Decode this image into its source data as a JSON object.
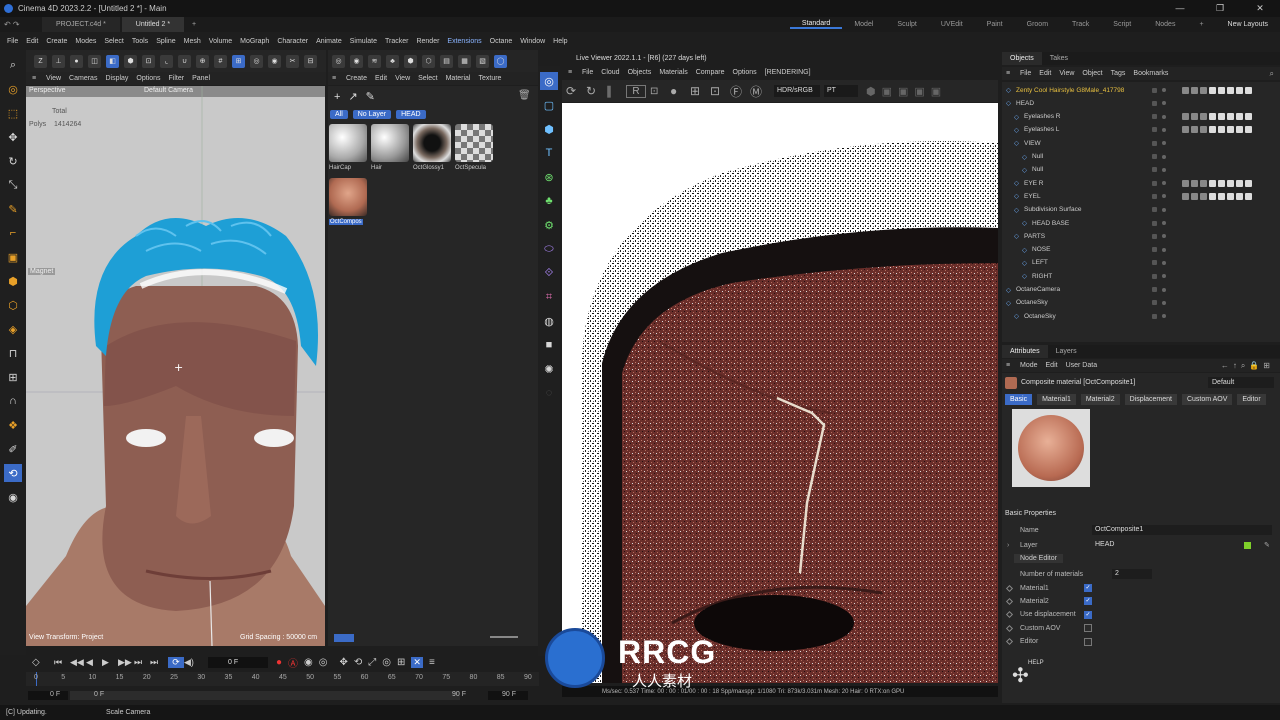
{
  "window": {
    "title": "Cinema 4D 2023.2.2 - [Untitled 2 *] - Main",
    "controls": [
      "—",
      "❐",
      "✕"
    ]
  },
  "file_tabs": [
    {
      "label": "PROJECT.c4d *",
      "active": false
    },
    {
      "label": "Untitled 2 *",
      "active": true
    },
    {
      "label": "+",
      "active": false
    }
  ],
  "layouts": [
    "Standard",
    "Model",
    "Sculpt",
    "UVEdit",
    "Paint",
    "Groom",
    "Track",
    "Script",
    "Nodes",
    "+",
    "New Layouts"
  ],
  "menubar": [
    "File",
    "Edit",
    "Create",
    "Modes",
    "Select",
    "Tools",
    "Spline",
    "Mesh",
    "Volume",
    "MoGraph",
    "Character",
    "Animate",
    "Simulate",
    "Tracker",
    "Render",
    "Extensions",
    "Octane",
    "Window",
    "Help"
  ],
  "viewport": {
    "menu": [
      "View",
      "Cameras",
      "Display",
      "Options",
      "Filter",
      "Panel"
    ],
    "label": "Perspective",
    "camera": "Default Camera",
    "total_label": "Total",
    "polys_label": "Polys",
    "polys_value": "1414264",
    "magnet_label": "Magnet",
    "transform_label": "View Transform: Project",
    "grid_spacing": "Grid Spacing : 50000 cm"
  },
  "material_manager": {
    "menu": [
      "Create",
      "Edit",
      "View",
      "Select",
      "Material",
      "Texture"
    ],
    "chips": [
      "All",
      "No Layer",
      "HEAD"
    ],
    "materials": [
      {
        "name": "HairCap",
        "color": "#e8e8e8"
      },
      {
        "name": "Hair",
        "color": "#d0d0d0"
      },
      {
        "name": "OctGlossy1",
        "color": "#2a2320"
      },
      {
        "name": "OctSpecula",
        "color": "#bbbbbb"
      },
      {
        "name": "OctCompos",
        "color": "#c8846a"
      }
    ]
  },
  "animation": {
    "current_frame": "0 F",
    "start_frame": "0 F",
    "start_frame2": "0 F",
    "end_frame": "90 F",
    "end_frame2": "90 F",
    "ticks": [
      "0",
      "5",
      "10",
      "15",
      "20",
      "25",
      "30",
      "35",
      "40",
      "45",
      "50",
      "55",
      "60",
      "65",
      "70",
      "75",
      "80",
      "85",
      "90"
    ]
  },
  "status_bar": {
    "updating": "[C] Updating.",
    "tool": "Scale Camera"
  },
  "live_viewer": {
    "title": "Live Viewer 2022.1.1 - [R6] (227 days left)",
    "menu": [
      "File",
      "Cloud",
      "Objects",
      "Materials",
      "Compare",
      "Options",
      "[RENDERING]"
    ],
    "color_space": "HDR/sRGB",
    "channel": "PT",
    "status": "Ms/sec: 0.537   Time: 00 : 00 : 01/00 : 00 : 18   Spp/maxspp: 1/1080   Tri: 873k/3.031m   Mesh: 20   Hair: 0   RTX:on   GPU"
  },
  "objects_panel": {
    "tabs": [
      "Objects",
      "Takes"
    ],
    "menu": [
      "File",
      "Edit",
      "View",
      "Object",
      "Tags",
      "Bookmarks"
    ],
    "tree": [
      {
        "name": "Zenty Cool Hairstyle G8Male_417798",
        "depth": 0,
        "color": "#e8c040"
      },
      {
        "name": "HEAD",
        "depth": 0,
        "color": "#cccccc"
      },
      {
        "name": "Eyelashes R",
        "depth": 1,
        "color": "#cccccc"
      },
      {
        "name": "Eyelashes L",
        "depth": 1,
        "color": "#cccccc"
      },
      {
        "name": "VIEW",
        "depth": 1,
        "color": "#cccccc"
      },
      {
        "name": "Null",
        "depth": 2,
        "color": "#cccccc"
      },
      {
        "name": "Null",
        "depth": 2,
        "color": "#cccccc"
      },
      {
        "name": "EYE R",
        "depth": 1,
        "color": "#cccccc"
      },
      {
        "name": "EYEL",
        "depth": 1,
        "color": "#cccccc"
      },
      {
        "name": "Subdivision Surface",
        "depth": 1,
        "color": "#cccccc"
      },
      {
        "name": "HEAD BASE",
        "depth": 2,
        "color": "#cccccc"
      },
      {
        "name": "PARTS",
        "depth": 1,
        "color": "#cccccc"
      },
      {
        "name": "NOSE",
        "depth": 2,
        "color": "#cccccc"
      },
      {
        "name": "LEFT",
        "depth": 2,
        "color": "#cccccc"
      },
      {
        "name": "RIGHT",
        "depth": 2,
        "color": "#cccccc"
      },
      {
        "name": "OctaneCamera",
        "depth": 0,
        "color": "#cccccc"
      },
      {
        "name": "OctaneSky",
        "depth": 0,
        "color": "#cccccc"
      },
      {
        "name": "OctaneSky",
        "depth": 1,
        "color": "#cccccc"
      }
    ]
  },
  "attributes": {
    "tabs": [
      "Attributes",
      "Layers"
    ],
    "menu": [
      "Mode",
      "Edit",
      "User Data"
    ],
    "object_title": "Composite material [OctComposite1]",
    "preset": "Default",
    "sub_tabs": [
      "Basic",
      "Material1",
      "Material2",
      "Displacement",
      "Custom AOV",
      "Editor"
    ],
    "section": "Basic Properties",
    "name_label": "Name",
    "name_value": "OctComposite1",
    "layer_label": "Layer",
    "layer_value": "HEAD",
    "node_editor": "Node Editor",
    "num_materials_label": "Number of materials",
    "num_materials_value": "2",
    "checkboxes": [
      {
        "label": "Material1",
        "checked": true
      },
      {
        "label": "Material2",
        "checked": true
      },
      {
        "label": "Use displacement",
        "checked": true
      },
      {
        "label": "Custom AOV",
        "checked": false
      },
      {
        "label": "Editor",
        "checked": false
      }
    ],
    "help_label": "HELP"
  },
  "watermark": {
    "brand": "RRCG",
    "sub": "人人素材"
  }
}
